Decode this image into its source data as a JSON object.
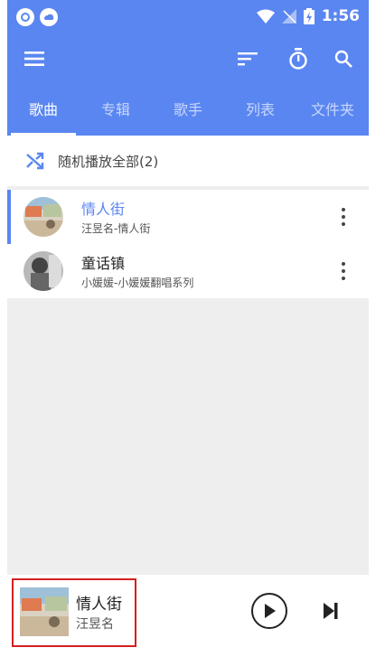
{
  "status_bar": {
    "time": "1:56",
    "icons": [
      "app-circle-icon",
      "cloud-app-icon",
      "wifi-icon",
      "no-signal-icon",
      "battery-charging-icon"
    ]
  },
  "app_bar": {
    "icons": [
      "menu-icon",
      "sort-icon",
      "timer-icon",
      "search-icon"
    ]
  },
  "tabs": [
    {
      "label": "歌曲",
      "active": true
    },
    {
      "label": "专辑",
      "active": false
    },
    {
      "label": "歌手",
      "active": false
    },
    {
      "label": "列表",
      "active": false
    },
    {
      "label": "文件夹",
      "active": false
    }
  ],
  "shuffle": {
    "label": "随机播放全部(2)",
    "icon": "shuffle-icon"
  },
  "songs": [
    {
      "title": "情人街",
      "subtitle": "汪昱名-情人街",
      "playing": true
    },
    {
      "title": "童话镇",
      "subtitle": "小媛媛-小媛媛翻唱系列",
      "playing": false
    }
  ],
  "now_playing": {
    "title": "情人街",
    "artist": "汪昱名",
    "controls": [
      "play-icon",
      "skip-next-icon"
    ]
  },
  "colors": {
    "primary": "#5a86f1",
    "highlight_box": "#d32020",
    "background": "#eeeeee"
  }
}
